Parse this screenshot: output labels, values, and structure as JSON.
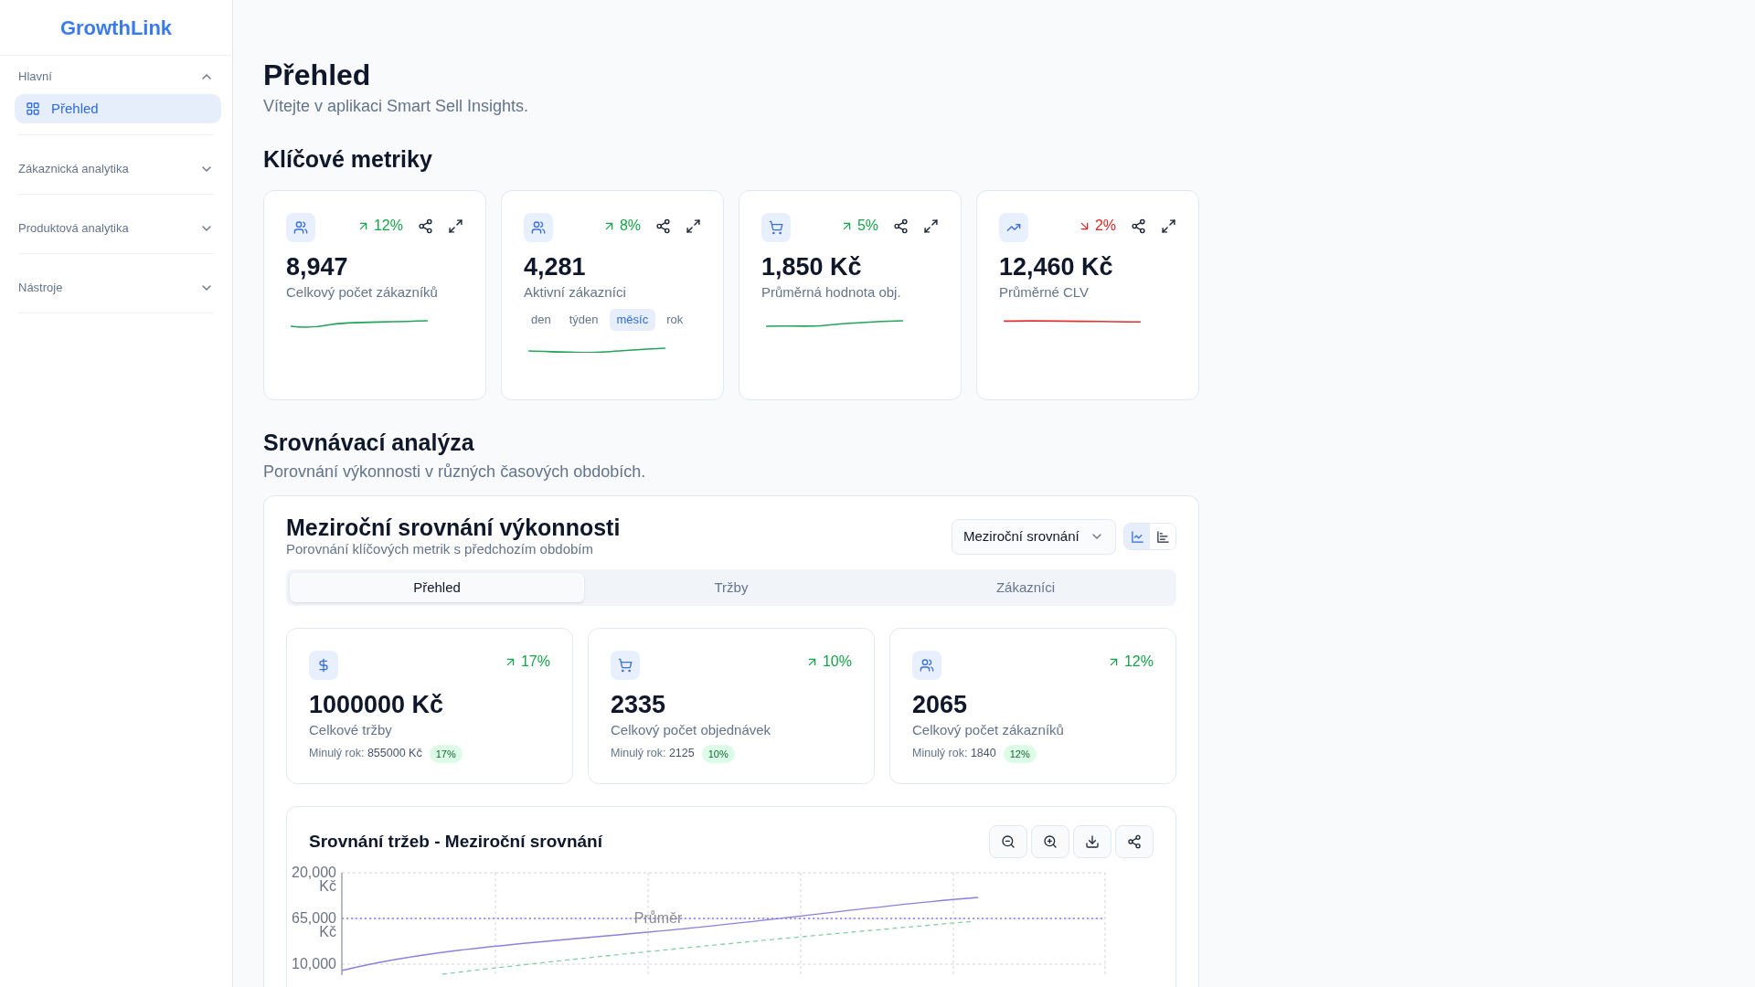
{
  "sidebar": {
    "logo": "GrowthLink",
    "sections": [
      {
        "label": "Hlavní",
        "expanded": true,
        "items": [
          {
            "label": "Přehled",
            "selected": true
          }
        ]
      },
      {
        "label": "Zákaznická analytika",
        "expanded": false
      },
      {
        "label": "Produktová analytika",
        "expanded": false
      },
      {
        "label": "Nástroje",
        "expanded": false
      }
    ]
  },
  "header": {
    "title": "Přehled",
    "subtitle": "Vítejte v aplikaci Smart Sell Insights."
  },
  "metrics": {
    "title": "Klíčové metriky",
    "cards": [
      {
        "kind": "users",
        "declining": false,
        "change": "12%",
        "value": "8,947",
        "label": "Celkový počet zákazníků"
      },
      {
        "kind": "users",
        "declining": false,
        "change": "8%",
        "value": "4,281",
        "label": "Aktivní zákazníci",
        "periods": [
          {
            "label": "den",
            "selected": false
          },
          {
            "label": "týden",
            "selected": false
          },
          {
            "label": "měsíc",
            "selected": true
          },
          {
            "label": "rok",
            "selected": false
          }
        ]
      },
      {
        "kind": "cart",
        "declining": false,
        "change": "5%",
        "value": "1,850 Kč",
        "label": "Průměrná hodnota obj."
      },
      {
        "kind": "trending",
        "declining": true,
        "change": "2%",
        "value": "12,460 Kč",
        "label": "Průměrné CLV"
      }
    ]
  },
  "comparison": {
    "title": "Srovnávací analýza",
    "subtitle": "Porovnání výkonnosti v různých časových obdobích.",
    "panel": {
      "title": "Meziroční srovnání výkonnosti",
      "subtitle": "Porovnání klíčových metrik s předchozím obdobím",
      "dropdown": {
        "value": "Meziroční srovnání"
      },
      "view_toggle": [
        {
          "kind": "line",
          "selected": true
        },
        {
          "kind": "bar",
          "selected": false
        }
      ],
      "tabs": [
        {
          "label": "Přehled",
          "selected": true
        },
        {
          "label": "Tržby",
          "selected": false
        },
        {
          "label": "Zákazníci",
          "selected": false
        }
      ],
      "cards": [
        {
          "kind": "dollar",
          "declining": false,
          "change": "17%",
          "value": "1000000 Kč",
          "label": "Celkové tržby",
          "previous_label": "Minulý rok:",
          "previous": "855000 Kč",
          "badge": "17%"
        },
        {
          "kind": "cart",
          "declining": false,
          "change": "10%",
          "value": "2335",
          "label": "Celkový počet objednávek",
          "previous_label": "Minulý rok:",
          "previous": "2125",
          "badge": "10%"
        },
        {
          "kind": "users",
          "declining": false,
          "change": "12%",
          "value": "2065",
          "label": "Celkový počet zákazníků",
          "previous_label": "Minulý rok:",
          "previous": "1840",
          "badge": "12%"
        }
      ],
      "chart": {
        "title": "Srovnání tržeb - Meziroční srovnání",
        "y_tick_labels": [
          "20,000 Kč",
          "65,000 Kč",
          "10,000"
        ],
        "average_label": "Průměr"
      }
    }
  }
}
